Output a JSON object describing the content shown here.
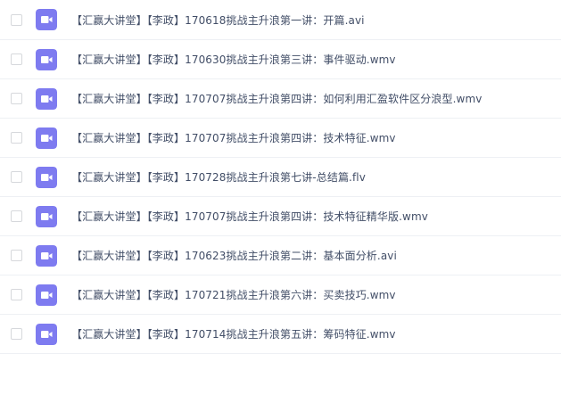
{
  "colors": {
    "icon_bg": "#7e7bf0",
    "icon_fg": "#ffffff",
    "text": "#424e67",
    "divider": "#eef0f4"
  },
  "files": [
    {
      "icon": "video-file-icon",
      "name": "【汇赢大讲堂】【李政】170618挑战主升浪第一讲：开篇.avi"
    },
    {
      "icon": "video-file-icon",
      "name": "【汇赢大讲堂】【李政】170630挑战主升浪第三讲：事件驱动.wmv"
    },
    {
      "icon": "video-file-icon",
      "name": "【汇赢大讲堂】【李政】170707挑战主升浪第四讲：如何利用汇盈软件区分浪型.wmv"
    },
    {
      "icon": "video-file-icon",
      "name": "【汇赢大讲堂】【李政】170707挑战主升浪第四讲：技术特征.wmv"
    },
    {
      "icon": "video-file-icon",
      "name": "【汇赢大讲堂】【李政】170728挑战主升浪第七讲-总结篇.flv"
    },
    {
      "icon": "video-file-icon",
      "name": "【汇赢大讲堂】【李政】170707挑战主升浪第四讲：技术特征精华版.wmv"
    },
    {
      "icon": "video-file-icon",
      "name": "【汇赢大讲堂】【李政】170623挑战主升浪第二讲：基本面分析.avi"
    },
    {
      "icon": "video-file-icon",
      "name": "【汇赢大讲堂】【李政】170721挑战主升浪第六讲：买卖技巧.wmv"
    },
    {
      "icon": "video-file-icon",
      "name": "【汇赢大讲堂】【李政】170714挑战主升浪第五讲：筹码特征.wmv"
    }
  ]
}
